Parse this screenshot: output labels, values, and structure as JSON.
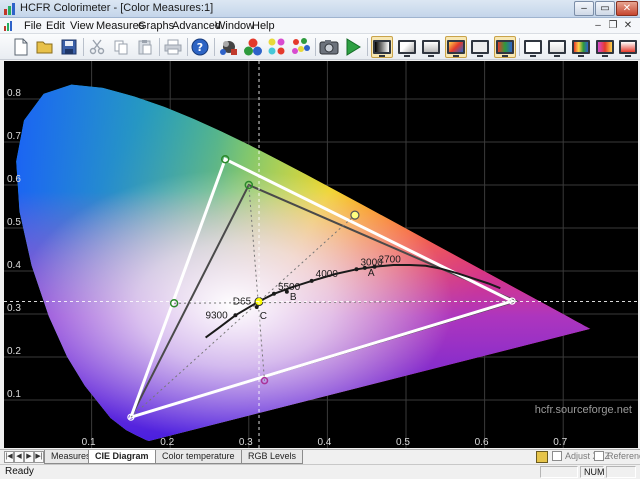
{
  "window": {
    "title": "HCFR Colorimeter - [Color Measures:1]"
  },
  "menu": {
    "items": [
      {
        "label": "File"
      },
      {
        "label": "Edit"
      },
      {
        "label": "View"
      },
      {
        "label": "Measures"
      },
      {
        "label": "Graphs"
      },
      {
        "label": "Advanced"
      },
      {
        "label": "Window"
      },
      {
        "label": "Help"
      }
    ]
  },
  "toolbar": {
    "icons": [
      "new-file-icon",
      "open-folder-icon",
      "save-icon",
      "cut-icon",
      "copy-icon",
      "paste-icon",
      "print-icon",
      "help-icon",
      "sensor-icon",
      "rgb-balls-icon",
      "colors-icon",
      "palette-icon",
      "camera-icon",
      "play-icon",
      "monitor-grayscale-icon",
      "monitor-primaries-icon",
      "monitor-secondaries-icon",
      "monitor-full-icon",
      "monitor-near-black-icon",
      "monitor-saturation-icon",
      "monitor-contrast-icon",
      "monitor-near-white-icon",
      "monitor-cie-icon",
      "monitor-gradient-icon",
      "monitor-luminance-icon"
    ]
  },
  "chart_data": {
    "type": "scatter",
    "title": "CIE Diagram",
    "xlabel": "",
    "ylabel": "",
    "xlim": [
      0.0,
      0.8
    ],
    "ylim": [
      0.0,
      0.9
    ],
    "x_ticks": [
      "0.1",
      "0.2",
      "0.3",
      "0.4",
      "0.5",
      "0.6",
      "0.7"
    ],
    "y_ticks": [
      "0.1",
      "0.2",
      "0.3",
      "0.4",
      "0.5",
      "0.6",
      "0.7",
      "0.8"
    ],
    "grid": true,
    "reference_gamut": {
      "red": [
        0.64,
        0.33
      ],
      "green": [
        0.3,
        0.6
      ],
      "blue": [
        0.15,
        0.06
      ]
    },
    "measured_gamut": {
      "red": [
        0.635,
        0.33
      ],
      "green": [
        0.27,
        0.66
      ],
      "blue": [
        0.15,
        0.06
      ]
    },
    "measured_secondaries": {
      "yellow": [
        0.435,
        0.53
      ],
      "cyan": [
        0.205,
        0.325
      ],
      "magenta": [
        0.32,
        0.145
      ]
    },
    "white_point": [
      0.313,
      0.329
    ],
    "crosshair": {
      "x": 0.313,
      "y": 0.329
    },
    "blackbody_labels": [
      {
        "label": "2700",
        "x": 0.46,
        "y": 0.41
      },
      {
        "label": "3000",
        "x": 0.437,
        "y": 0.404
      },
      {
        "label": "4000",
        "x": 0.38,
        "y": 0.377
      },
      {
        "label": "5500",
        "x": 0.332,
        "y": 0.347
      },
      {
        "label": "D65",
        "x": 0.3127,
        "y": 0.329
      },
      {
        "label": "9300",
        "x": 0.283,
        "y": 0.297
      }
    ],
    "illuminant_labels": [
      {
        "label": "A",
        "x": 0.4476,
        "y": 0.4074
      },
      {
        "label": "B",
        "x": 0.3484,
        "y": 0.3516
      },
      {
        "label": "C",
        "x": 0.3101,
        "y": 0.3162
      }
    ],
    "watermark": "hcfr.sourceforge.net"
  },
  "tabs": {
    "items": [
      {
        "label": "Measures"
      },
      {
        "label": "CIE Diagram"
      },
      {
        "label": "Color temperature"
      },
      {
        "label": "RGB Levels"
      }
    ],
    "active": 1,
    "adjust_label": "Adjust XYZ",
    "reference_label": "Reference"
  },
  "status": {
    "text": "Ready",
    "num": "NUM"
  }
}
